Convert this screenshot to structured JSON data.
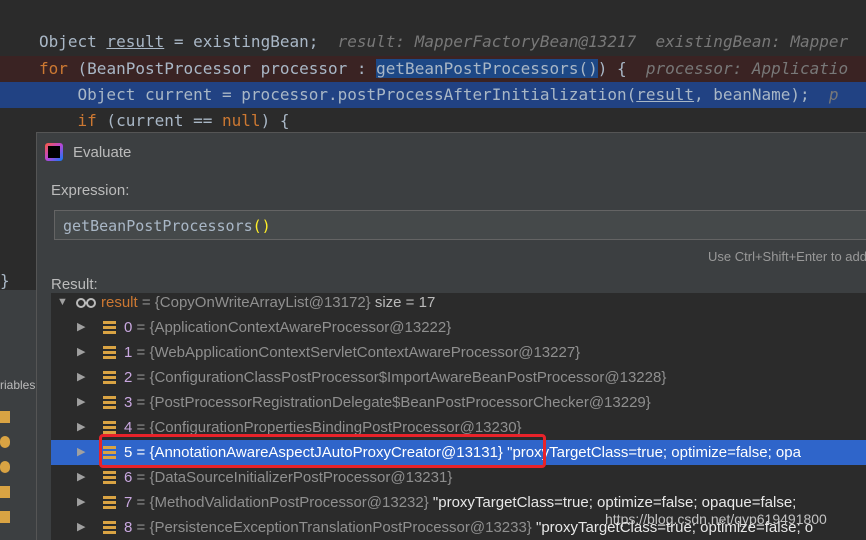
{
  "code": {
    "line1": {
      "a": "Object ",
      "var": "result",
      "b": " = existingBean;",
      "hint": "  result: MapperFactoryBean@13217  existingBean: Mapper"
    },
    "line2": {
      "kw": "for",
      "a": " (BeanPostProcessor processor : ",
      "call": "getBeanPostProcessors()",
      "b": ") {",
      "hint": "  processor: Applicatio"
    },
    "line3": {
      "a": "    Object current = processor.postProcessAfterInitialization(",
      "var": "result",
      "b": ", beanName);",
      "hint": "  p"
    },
    "line4": {
      "a": "    ",
      "kw": "if",
      "b": " (current == ",
      "kw2": "null",
      "c": ") {"
    },
    "closing_brace": "}"
  },
  "sidebar": {
    "variables_label": "riables"
  },
  "dialog": {
    "title": "Evaluate",
    "expression_label": "Expression:",
    "expression": "getBeanPostProcessors",
    "expression_parens": "()",
    "shortcut_hint": "Use Ctrl+Shift+Enter to add",
    "result_label": "Result:"
  },
  "result": {
    "root": {
      "name": "result",
      "value": " = {CopyOnWriteArrayList@13172}",
      "size": "  size = 17"
    },
    "items": [
      {
        "index": "0",
        "value": " = {ApplicationContextAwareProcessor@13222}",
        "extra": ""
      },
      {
        "index": "1",
        "value": " = {WebApplicationContextServletContextAwareProcessor@13227}",
        "extra": ""
      },
      {
        "index": "2",
        "value": " = {ConfigurationClassPostProcessor$ImportAwareBeanPostProcessor@13228}",
        "extra": ""
      },
      {
        "index": "3",
        "value": " = {PostProcessorRegistrationDelegate$BeanPostProcessorChecker@13229}",
        "extra": ""
      },
      {
        "index": "4",
        "value": " = {ConfigurationPropertiesBindingPostProcessor@13230}",
        "extra": ""
      },
      {
        "index": "5",
        "value": " = {AnnotationAwareAspectJAutoProxyCreator@13131}",
        "extra": " \"proxyTargetClass=true; optimize=false; opa"
      },
      {
        "index": "6",
        "value": " = {DataSourceInitializerPostProcessor@13231}",
        "extra": ""
      },
      {
        "index": "7",
        "value": " = {MethodValidationPostProcessor@13232}",
        "extra": " \"proxyTargetClass=true; optimize=false; opaque=false;"
      },
      {
        "index": "8",
        "value": " = {PersistenceExceptionTranslationPostProcessor@13233}",
        "extra": " \"proxyTargetClass=true; optimize=false; o"
      }
    ],
    "selected_index": 5
  },
  "watermark": "https://blog.csdn.net/qyp619491800",
  "colors": {
    "highlight_box": "#e8232a",
    "selection": "#2f65ca",
    "keyword": "#cc7832"
  }
}
